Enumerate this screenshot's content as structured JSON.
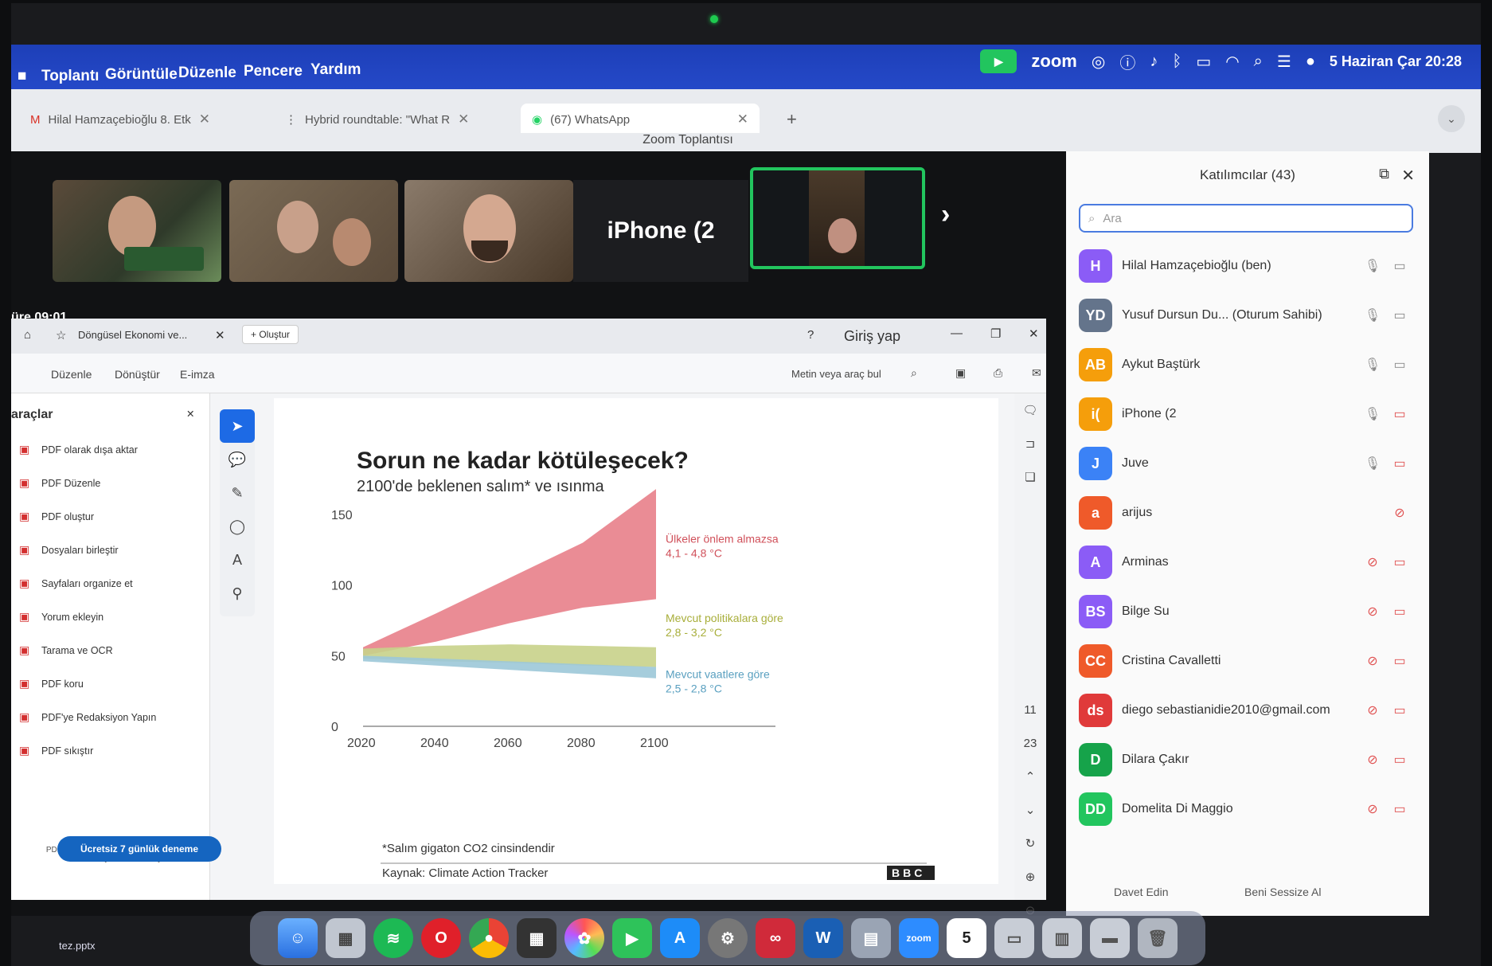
{
  "menubar": {
    "items": [
      "Toplantı",
      "Görüntüle",
      "Düzenle",
      "Pencere",
      "Yardım"
    ],
    "brand": "zoom",
    "datetime": "5 Haziran Çar  20:28"
  },
  "browser": {
    "tabs": [
      {
        "label": "Hilal Hamzaçebioğlu 8. Etk"
      },
      {
        "label": "Hybrid roundtable: \"What R"
      },
      {
        "label": "(67) WhatsApp"
      }
    ],
    "new_tab": "+"
  },
  "zoom": {
    "window_title": "Zoom Toplantısı",
    "strip_label": "iPhone (2",
    "timer": "üre  09:01"
  },
  "acrobat": {
    "doc_tab": "Döngüsel Ekonomi ve...",
    "create_button": "+ Oluştur",
    "signin": "Giriş yap",
    "toolbar_items": [
      "Düzenle",
      "Dönüştür",
      "E-imza"
    ],
    "search_placeholder": "Metin veya araç bul",
    "tools_title": "araçlar",
    "tools": [
      "PDF olarak dışa aktar",
      "PDF Düzenle",
      "PDF oluştur",
      "Dosyaları birleştir",
      "Sayfaları organize et",
      "Yorum ekleyin",
      "Tarama ve OCR",
      "PDF koru",
      "PDF'ye Redaksiyon Yapın",
      "PDF sıkıştır"
    ],
    "promo": "PDF formlarını ve sözleşmeleri dönüştürün, düzenleyin ve e-imzalayın",
    "trial_button": "Ücretsiz 7 günlük deneme",
    "page_numbers": [
      "11",
      "23"
    ]
  },
  "participants": {
    "title": "Katılımcılar (43)",
    "search_placeholder": "Ara",
    "list": [
      {
        "initials": "H",
        "name": "Hilal Hamzaçebioğlu (ben)",
        "color": "#8b5cf6"
      },
      {
        "initials": "YD",
        "name": "Yusuf Dursun Du... (Oturum Sahibi)",
        "color": "#64748b"
      },
      {
        "initials": "AB",
        "name": "Aykut Baştürk",
        "color": "#f59e0b"
      },
      {
        "initials": "i(",
        "name": "iPhone (2",
        "color": "#f59e0b"
      },
      {
        "initials": "J",
        "name": "Juve",
        "color": "#3b82f6"
      },
      {
        "initials": "a",
        "name": "arijus",
        "color": "#ef5a2a"
      },
      {
        "initials": "A",
        "name": "Arminas",
        "color": "#8b5cf6"
      },
      {
        "initials": "BS",
        "name": "Bilge Su",
        "color": "#8b5cf6"
      },
      {
        "initials": "CC",
        "name": "Cristina Cavalletti",
        "color": "#ef5a2a"
      },
      {
        "initials": "ds",
        "name": "diego sebastianidie2010@gmail.com",
        "color": "#e03a3a"
      },
      {
        "initials": "D",
        "name": "Dilara Çakır",
        "color": "#16a34a"
      },
      {
        "initials": "DD",
        "name": "Domelita Di Maggio",
        "color": "#22c55e"
      }
    ],
    "invite": "Davet Edin",
    "mute": "Beni Sessize Al"
  },
  "chart_data": {
    "type": "area",
    "title": "Sorun ne kadar kötüleşecek?",
    "subtitle": "2100'de beklenen salım* ve ısınma",
    "x": [
      2020,
      2040,
      2060,
      2080,
      2100
    ],
    "xlim": [
      2020,
      2100
    ],
    "ylim": [
      0,
      150
    ],
    "yticks": [
      0,
      50,
      100,
      150
    ],
    "grid": false,
    "series": [
      {
        "name": "Ülkeler önlem almazsa 4,1 - 4,8 °C",
        "color": "#e8808a",
        "upper": [
          56,
          80,
          105,
          130,
          168
        ],
        "lower": [
          50,
          60,
          73,
          84,
          90
        ]
      },
      {
        "name": "Mevcut politikalara göre 2,8 - 3,2 °C",
        "color": "#c8d28a",
        "upper": [
          55,
          57,
          58,
          57,
          56
        ],
        "lower": [
          48,
          46,
          45,
          43,
          42
        ]
      },
      {
        "name": "Mevcut vaatlere göre 2,5 - 2,8 °C",
        "color": "#9cc8d8",
        "upper": [
          50,
          48,
          46,
          44,
          42
        ],
        "lower": [
          46,
          43,
          40,
          37,
          34
        ]
      }
    ],
    "labels": [
      {
        "text": "Ülkeler önlem almazsa",
        "text2": "4,1 - 4,8 °C"
      },
      {
        "text": "Mevcut politikalara göre",
        "text2": "2,8 - 3,2 °C"
      },
      {
        "text": "Mevcut vaatlere göre",
        "text2": "2,5 - 2,8 °C"
      }
    ],
    "footnote": "*Salım gigaton CO2 cinsindendir",
    "source": "Kaynak: Climate Action Tracker",
    "logo": "BBC"
  },
  "dock": {
    "file_label": "tez.pptx",
    "calendar_day": "5"
  }
}
